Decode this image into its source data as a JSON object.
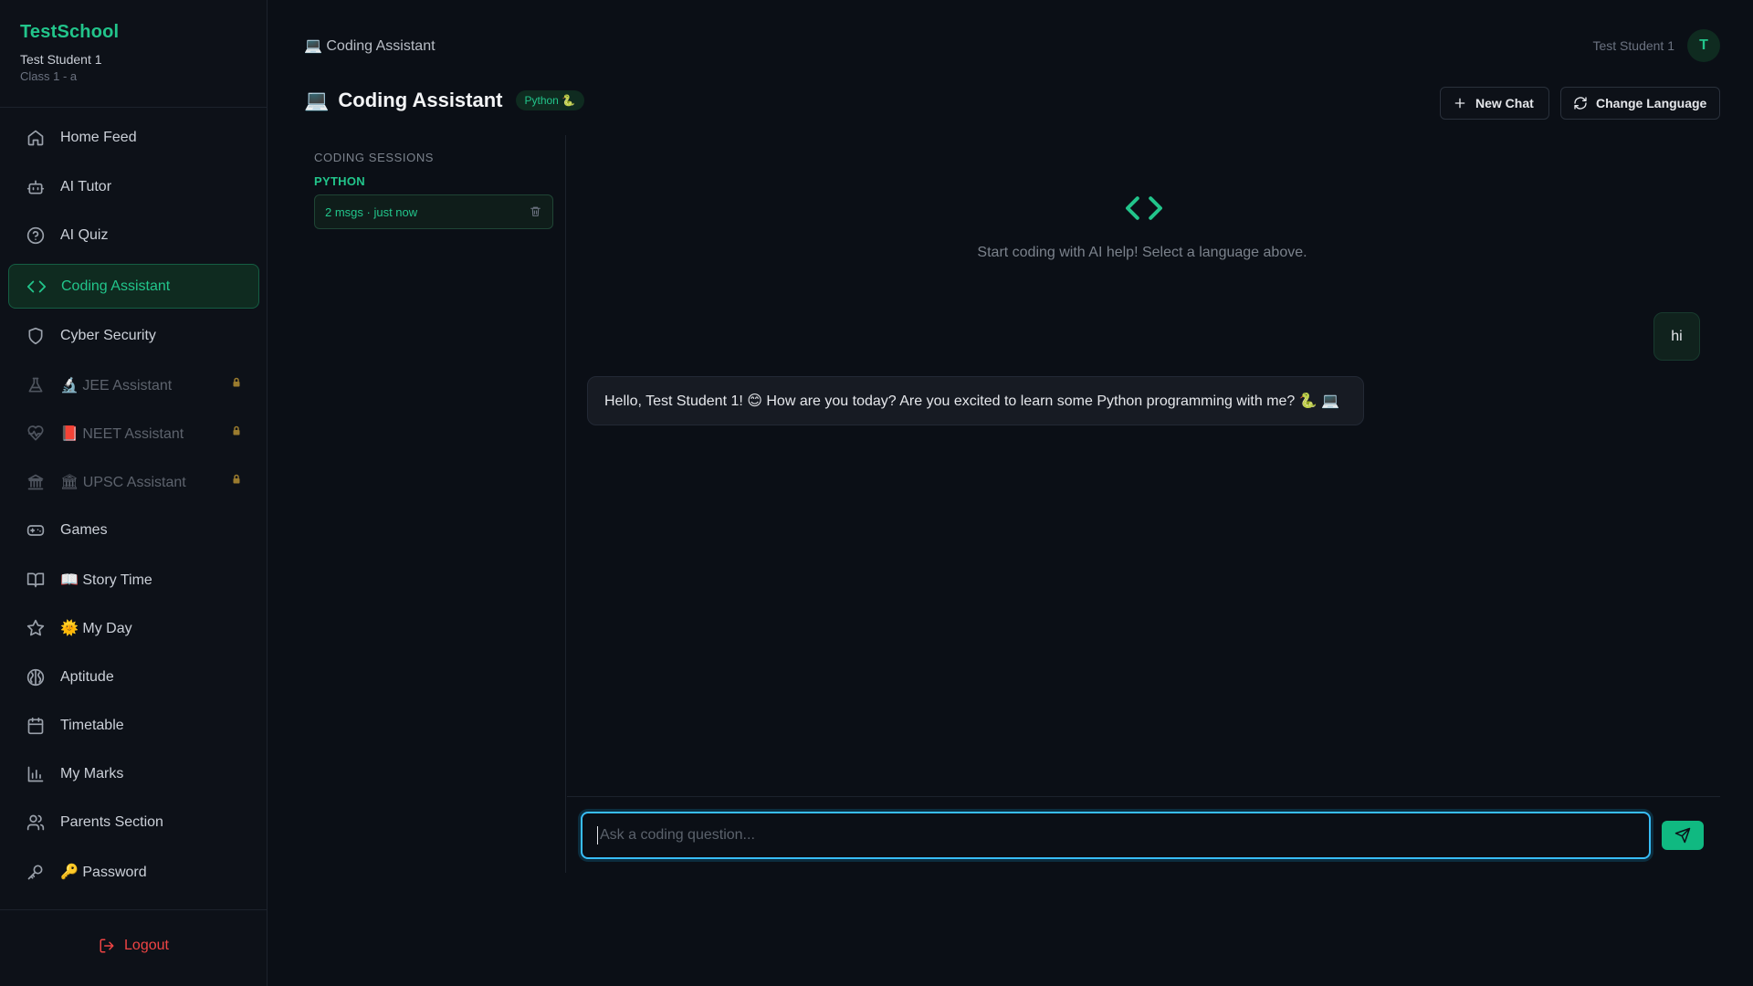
{
  "app": {
    "name": "TestSchool",
    "user": "Test Student 1",
    "class": "Class 1 - a"
  },
  "sidebar": {
    "items": [
      {
        "label": "Home Feed",
        "icon": "home-icon"
      },
      {
        "label": "AI Tutor",
        "icon": "bot-icon"
      },
      {
        "label": "AI Quiz",
        "icon": "help-circle-icon"
      },
      {
        "label": "Coding Assistant",
        "icon": "code-icon"
      },
      {
        "label": "Cyber Security",
        "icon": "shield-icon"
      },
      {
        "label": "🔬 JEE Assistant",
        "icon": "flask-icon"
      },
      {
        "label": "📕 NEET Assistant",
        "icon": "heart-pulse-icon"
      },
      {
        "label": "🏛 UPSC Assistant",
        "icon": "bank-icon"
      },
      {
        "label": "Games",
        "icon": "gamepad-icon"
      },
      {
        "label": "📖 Story Time",
        "icon": "book-icon"
      },
      {
        "label": "🌞 My Day",
        "icon": "star-icon"
      },
      {
        "label": "Aptitude",
        "icon": "brain-icon"
      },
      {
        "label": "Timetable",
        "icon": "calendar-icon"
      },
      {
        "label": "My Marks",
        "icon": "bar-chart-icon"
      },
      {
        "label": "Parents Section",
        "icon": "users-icon"
      },
      {
        "label": "🔑 Password",
        "icon": "key-icon"
      }
    ],
    "logout": "Logout"
  },
  "header": {
    "breadcrumb": "💻 Coding Assistant",
    "user_name": "Test Student 1",
    "avatar_letter": "T",
    "title_emoji": "💻",
    "title": "Coding Assistant",
    "language_badge": "Python 🐍",
    "new_chat": "New Chat",
    "change_language": "Change Language"
  },
  "sessions": {
    "heading": "CODING SESSIONS",
    "language": "PYTHON",
    "items": [
      {
        "label": "2 msgs · just now"
      }
    ]
  },
  "chat": {
    "empty_text": "Start coding with AI help! Select a language above.",
    "messages": [
      {
        "role": "user",
        "text": "hi"
      },
      {
        "role": "assistant",
        "text": "Hello, Test Student 1! 😊 How are you today? Are you excited to learn some Python programming with me? 🐍 💻"
      }
    ],
    "input_placeholder": "Ask a coding question..."
  },
  "colors": {
    "accent": "#22c58b",
    "background": "#0b0f16",
    "danger": "#ef4444",
    "focus": "#38bdf8"
  }
}
